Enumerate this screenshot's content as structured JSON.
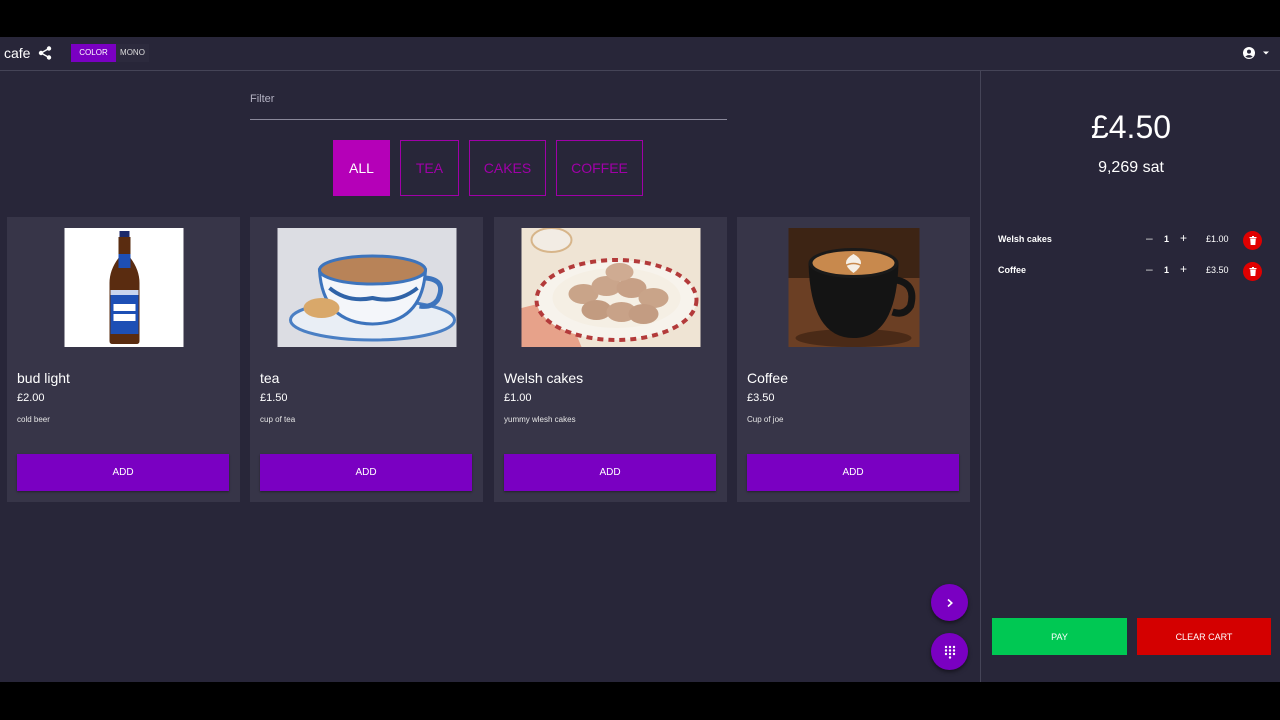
{
  "header": {
    "title": "cafe",
    "share_icon": "share-icon",
    "theme": {
      "color_label": "COLOR",
      "mono_label": "MONO",
      "selected": "COLOR"
    },
    "account_icon": "account-circle-icon"
  },
  "filter": {
    "label": "Filter",
    "value": ""
  },
  "categories": [
    "ALL",
    "TEA",
    "CAKES",
    "COFFEE"
  ],
  "selected_category": "ALL",
  "products": [
    {
      "name": "bud light",
      "price": "£2.00",
      "description": "cold beer",
      "add_label": "ADD",
      "image": "beer-bottle"
    },
    {
      "name": "tea",
      "price": "£1.50",
      "description": "cup of tea",
      "add_label": "ADD",
      "image": "tea-cup"
    },
    {
      "name": "Welsh cakes",
      "price": "£1.00",
      "description": "yummy wlesh cakes",
      "add_label": "ADD",
      "image": "welsh-cakes-plate"
    },
    {
      "name": "Coffee",
      "price": "£3.50",
      "description": "Cup of joe",
      "add_label": "ADD",
      "image": "latte-cup"
    }
  ],
  "cart": {
    "total": "£4.50",
    "sats": "9,269 sat",
    "items": [
      {
        "name": "Welsh cakes",
        "qty": "1",
        "price": "£1.00"
      },
      {
        "name": "Coffee",
        "qty": "1",
        "price": "£3.50"
      }
    ],
    "pay_label": "PAY",
    "clear_label": "CLEAR CART"
  },
  "colors": {
    "background": "#282639",
    "card": "#373548",
    "accent": "#7a00c2",
    "chip": "#b500b8",
    "pay": "#00c853",
    "clear": "#d40000"
  }
}
